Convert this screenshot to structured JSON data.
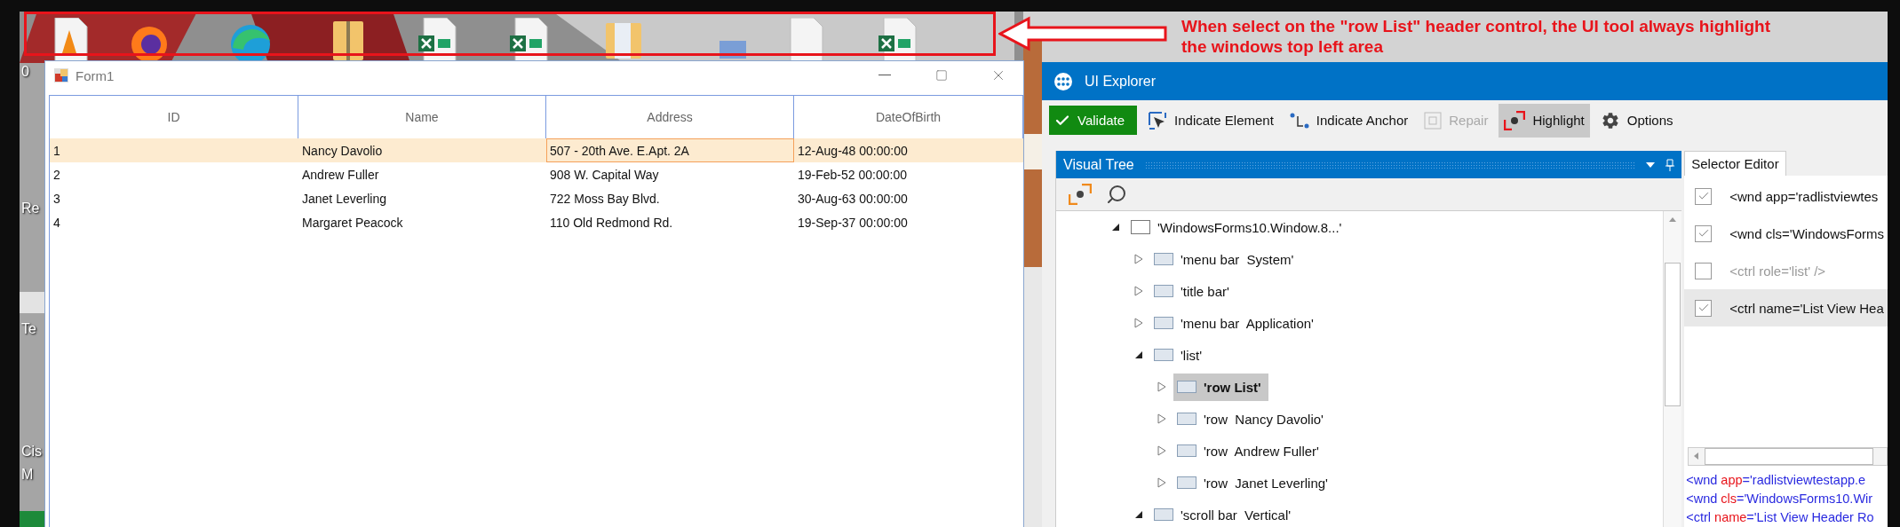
{
  "desktop": {
    "icon_labels": [
      {
        "text": "0"
      },
      {
        "text": "Re"
      },
      {
        "text": "Te"
      },
      {
        "text": "Cis"
      },
      {
        "text": "M"
      }
    ]
  },
  "annotation": {
    "lines": [
      "When select on the \"row List\" header control, the UI tool always highlight",
      "the windows top left area"
    ]
  },
  "form_window": {
    "title": "Form1",
    "columns": [
      "ID",
      "Name",
      "Address",
      "DateOfBirth"
    ],
    "rows": [
      {
        "selected": true,
        "cells": [
          {
            "text": "1",
            "focused": false
          },
          {
            "text": "Nancy Davolio",
            "focused": false
          },
          {
            "text": "507 - 20th Ave. E.Apt. 2A",
            "focused": true
          },
          {
            "text": "12-Aug-48 00:00:00",
            "focused": false
          }
        ]
      },
      {
        "selected": false,
        "cells": [
          {
            "text": "2",
            "focused": false
          },
          {
            "text": "Andrew Fuller",
            "focused": false
          },
          {
            "text": "908 W. Capital Way",
            "focused": false
          },
          {
            "text": "19-Feb-52 00:00:00",
            "focused": false
          }
        ]
      },
      {
        "selected": false,
        "cells": [
          {
            "text": "3",
            "focused": false
          },
          {
            "text": "Janet Leverling",
            "focused": false
          },
          {
            "text": "722 Moss Bay Blvd.",
            "focused": false
          },
          {
            "text": "30-Aug-63 00:00:00",
            "focused": false
          }
        ]
      },
      {
        "selected": false,
        "cells": [
          {
            "text": "4",
            "focused": false
          },
          {
            "text": "Margaret Peacock",
            "focused": false
          },
          {
            "text": "110 Old Redmond Rd.",
            "focused": false
          },
          {
            "text": "19-Sep-37 00:00:00",
            "focused": false
          }
        ]
      }
    ]
  },
  "ui_explorer": {
    "title": "UI Explorer",
    "toolbar": [
      {
        "kind": "validate",
        "label": "Validate",
        "disabled": false,
        "selected": false
      },
      {
        "kind": "indicate_element",
        "label": "Indicate Element",
        "disabled": false,
        "selected": false
      },
      {
        "kind": "indicate_anchor",
        "label": "Indicate Anchor",
        "disabled": false,
        "selected": false
      },
      {
        "kind": "repair",
        "label": "Repair",
        "disabled": true,
        "selected": false
      },
      {
        "kind": "highlight",
        "label": "Highlight",
        "disabled": false,
        "selected": true
      },
      {
        "kind": "options",
        "label": "Options",
        "disabled": false,
        "selected": false
      }
    ],
    "visual_tree": {
      "title": "Visual Tree",
      "nodes": [
        {
          "kind": "window",
          "label": "'WindowsForms10.Window.8...'",
          "expanded": true,
          "selected": false,
          "children": [
            {
              "kind": "element",
              "label": "'menu bar  System'",
              "expanded": false,
              "selected": false
            },
            {
              "kind": "element",
              "label": "'title bar'",
              "expanded": false,
              "selected": false
            },
            {
              "kind": "element",
              "label": "'menu bar  Application'",
              "expanded": false,
              "selected": false
            },
            {
              "kind": "element",
              "label": "'list'",
              "expanded": true,
              "selected": false,
              "children": [
                {
                  "kind": "element",
                  "label": "'row List'",
                  "expanded": false,
                  "selected": true
                },
                {
                  "kind": "element",
                  "label": "'row  Nancy Davolio'",
                  "expanded": false,
                  "selected": false
                },
                {
                  "kind": "element",
                  "label": "'row  Andrew Fuller'",
                  "expanded": false,
                  "selected": false
                },
                {
                  "kind": "element",
                  "label": "'row  Janet Leverling'",
                  "expanded": false,
                  "selected": false
                }
              ]
            },
            {
              "kind": "element",
              "label": "'scroll bar  Vertical'",
              "expanded": true,
              "selected": false
            }
          ]
        }
      ]
    },
    "selector_editor": {
      "tab": "Selector Editor",
      "items": [
        {
          "text": "<wnd app='radlistviewtes",
          "checked": true,
          "selected": false
        },
        {
          "text": "<wnd cls='WindowsForms",
          "checked": true,
          "selected": false
        },
        {
          "text": "<ctrl role='list' />",
          "checked": false,
          "selected": false
        },
        {
          "text": "<ctrl name='List View Hea",
          "checked": true,
          "selected": true
        }
      ],
      "preview": [
        [
          {
            "kind": "tag",
            "text": "<wnd "
          },
          {
            "kind": "attr",
            "text": "app"
          },
          {
            "kind": "value",
            "text": "='radlistviewtestapp.e"
          }
        ],
        [
          {
            "kind": "tag",
            "text": "<wnd "
          },
          {
            "kind": "attr",
            "text": "cls"
          },
          {
            "kind": "value",
            "text": "='WindowsForms10.Wir"
          }
        ],
        [
          {
            "kind": "tag",
            "text": "<ctrl "
          },
          {
            "kind": "attr",
            "text": "name"
          },
          {
            "kind": "value",
            "text": "='List View Header Ro"
          }
        ]
      ]
    }
  }
}
